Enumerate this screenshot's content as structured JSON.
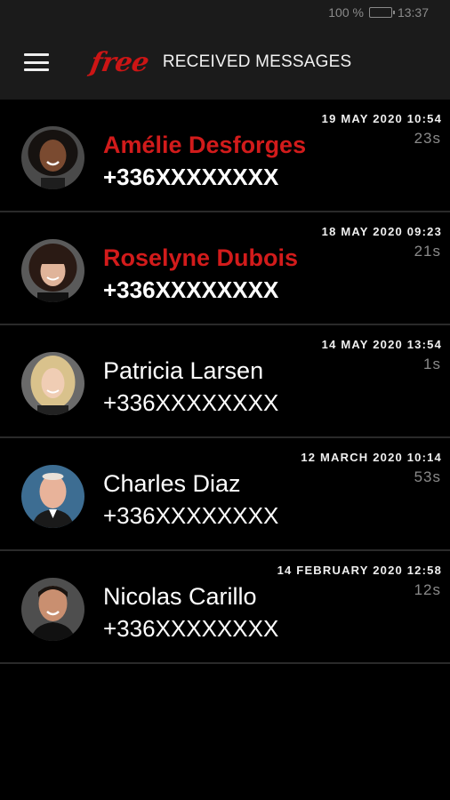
{
  "status_bar": {
    "battery_text": "100 %",
    "time": "13:37"
  },
  "header": {
    "logo": "free",
    "title": "RECEIVED MESSAGES",
    "menu_icon": "hamburger-menu-icon"
  },
  "messages": [
    {
      "name": "Amélie Desforges",
      "phone": "+336XXXXXXXX",
      "date": "19 MAY 2020 10:54",
      "duration": "23s",
      "unread": true
    },
    {
      "name": "Roselyne Dubois",
      "phone": "+336XXXXXXXX",
      "date": "18 MAY 2020 09:23",
      "duration": "21s",
      "unread": true
    },
    {
      "name": "Patricia Larsen",
      "phone": "+336XXXXXXXX",
      "date": "14 MAY 2020 13:54",
      "duration": "1s",
      "unread": false
    },
    {
      "name": "Charles Diaz",
      "phone": "+336XXXXXXXX",
      "date": "12 MARCH 2020 10:14",
      "duration": "53s",
      "unread": false
    },
    {
      "name": "Nicolas Carillo",
      "phone": "+336XXXXXXXX",
      "date": "14 FEBRUARY 2020 12:58",
      "duration": "12s",
      "unread": false
    }
  ],
  "colors": {
    "accent": "#d21b1b",
    "header_bg": "#1b1b1b",
    "background": "#000000"
  }
}
